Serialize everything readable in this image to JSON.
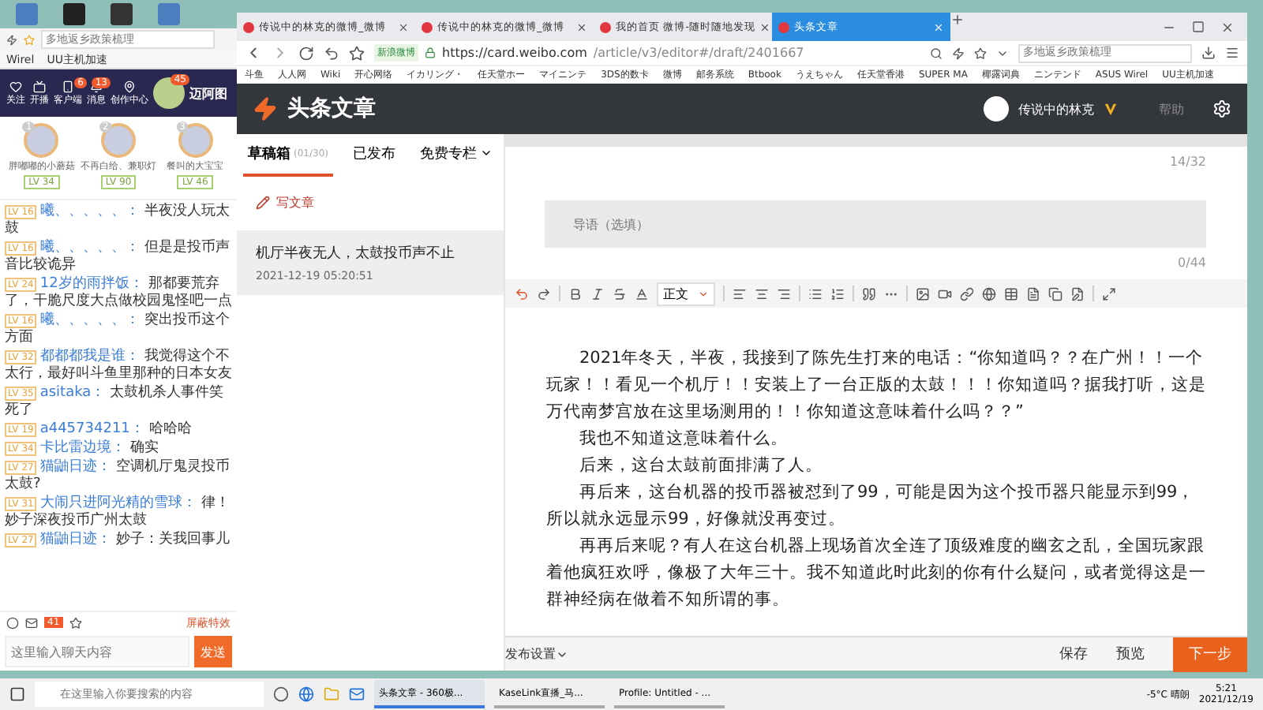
{
  "left_window": {
    "search_placeholder": "多地返乡政策梳理",
    "bookmarks": [
      "Wirel",
      "UU主机加速"
    ],
    "nav": [
      {
        "label": "关注"
      },
      {
        "label": "开播"
      },
      {
        "label": "客户端",
        "badge": "6"
      },
      {
        "label": "消息",
        "badge": "13"
      },
      {
        "label": "创作中心"
      }
    ],
    "avatar_badge": "45",
    "banner_text": "迈阿图",
    "ranking": [
      {
        "rank": "1",
        "name": "胖嘟嘟的小蘑菇",
        "level": "LV 34"
      },
      {
        "rank": "2",
        "name": "不再白给、兼职灯",
        "level": "LV 90"
      },
      {
        "rank": "3",
        "name": "餐叫的大宝宝",
        "level": "LV 46"
      }
    ],
    "chat": [
      {
        "level": "LV 16",
        "user": "曦、、、、、：",
        "text": "半夜没人玩太鼓"
      },
      {
        "level": "LV 16",
        "user": "曦、、、、、：",
        "text": "但是是投币声音比较诡异"
      },
      {
        "level": "LV 24",
        "user": "12岁的雨拌饭：",
        "text": "那都要荒弃了，干脆尺度大点做校园鬼怪吧一点"
      },
      {
        "level": "LV 16",
        "user": "曦、、、、、：",
        "text": "突出投币这个方面"
      },
      {
        "level": "LV 32",
        "user": "都都都我是谁：",
        "text": "我觉得这个不太行，最好叫斗鱼里那种的日本女友"
      },
      {
        "level": "LV 35",
        "user": "asitaka：",
        "text": "太鼓机杀人事件笑死了"
      },
      {
        "level": "LV 19",
        "user": "a445734211：",
        "text": "哈哈哈"
      },
      {
        "level": "LV 34",
        "user": "卡比雷边境：",
        "text": "确实"
      },
      {
        "level": "LV 27",
        "user": "猫鼬日迹：",
        "text": "空调机厅鬼灵投币太鼓?"
      },
      {
        "level": "LV 31",
        "user": "大闹只进阿光精的雪球：",
        "text": "律！妙子深夜投币广州太鼓"
      },
      {
        "level": "LV 27",
        "user": "猫鼬日迹：",
        "text": "妙子：关我回事儿"
      }
    ],
    "gift_count": "41",
    "effects_label": "屏蔽特效",
    "input_placeholder": "这里输入聊天内容",
    "send": "发送"
  },
  "browser": {
    "tabs": [
      {
        "title": "传说中的林克的微博_微博",
        "selected": false
      },
      {
        "title": "传说中的林克的微博_微博",
        "selected": false
      },
      {
        "title": "我的首页 微博-随时随地发现",
        "selected": false
      },
      {
        "title": "头条文章",
        "selected": true
      }
    ],
    "site_badge": "新浪微博",
    "url_host": "https://card.weibo.com",
    "url_path": "/article/v3/editor#/draft/2401667",
    "search_placeholder": "多地返乡政策梳理",
    "bookmarks": [
      "斗鱼",
      "人人网",
      "Wiki",
      "开心网络",
      "イカリング・",
      "任天堂ホー",
      "マイニンテ",
      "3DS的数卡",
      "微博",
      "邮务系统",
      "Btbook",
      "うえちゃん",
      "任天堂香港",
      "SUPER MA",
      "椰露词典",
      "ニンテンド",
      "ASUS Wirel",
      "UU主机加速"
    ]
  },
  "editor": {
    "title": "头条文章",
    "user": "传说中的林克",
    "help": "帮助",
    "side_tabs": [
      {
        "label": "草稿箱",
        "count": "(01/30)",
        "selected": true
      },
      {
        "label": "已发布",
        "selected": false
      },
      {
        "label": "免费专栏",
        "selected": false
      }
    ],
    "write": "写文章",
    "drafts": [
      {
        "title": "机厅半夜无人，太鼓投币声不止",
        "time": "2021-12-19 05:20:51",
        "selected": true
      }
    ],
    "title_counter": "14/32",
    "lead_placeholder": "导语（选填）",
    "lead_counter": "0/44",
    "style_select": "正文",
    "paragraphs": [
      "2021年冬天，半夜，我接到了陈先生打来的电话：“你知道吗？？在广州！！一个玩家！！看见一个机厅！！安装上了一台正版的太鼓！！！你知道吗？据我打听，这是万代南梦宫放在这里场测用的！！你知道这意味着什么吗？？”",
      "我也不知道这意味着什么。",
      "后来，这台太鼓前面排满了人。",
      "再后来，这台机器的投币器被怼到了99，可能是因为这个投币器只能显示到99，所以就永远显示99，好像就没再变过。",
      "再再后来呢？有人在这台机器上现场首次全连了顶级难度的幽玄之乱，全国玩家跟着他疯狂欢呼，像极了大年三十。我不知道此时此刻的你有什么疑问，或者觉得这是一群神经病在做着不知所谓的事。"
    ],
    "publish_settings": "发布设置",
    "save": "保存",
    "preview": "预览",
    "next": "下一步"
  },
  "taskbar": {
    "search_placeholder": "在这里输入你要搜索的内容",
    "windows": [
      {
        "label": "头条文章 - 360极...",
        "selected": true
      },
      {
        "label": "KaseLink直播_马...",
        "selected": false
      },
      {
        "label": "Profile: Untitled - ...",
        "selected": false
      }
    ],
    "weather": "-5°C 晴朗",
    "time": "5:21",
    "date": "2021/12/19"
  }
}
